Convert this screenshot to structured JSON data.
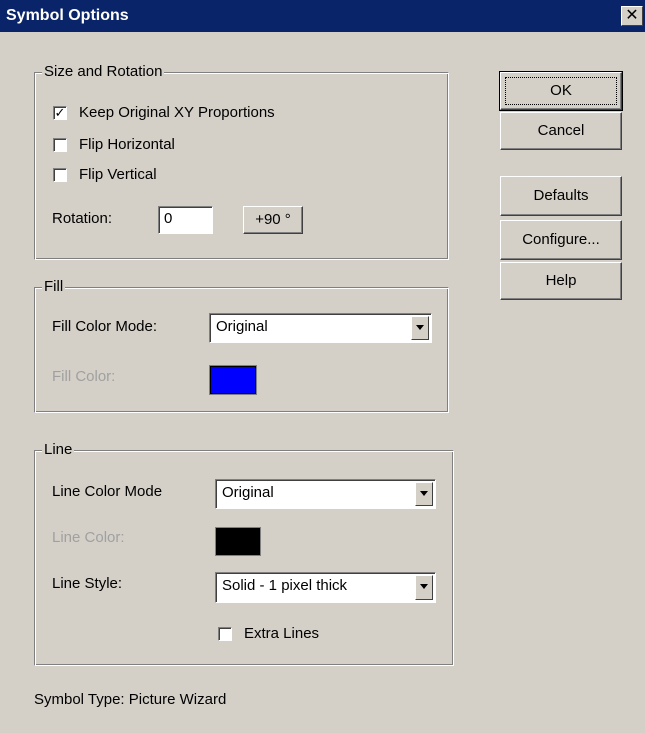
{
  "window": {
    "title": "Symbol Options",
    "close_glyph": "✕"
  },
  "size_rotation": {
    "legend": "Size and Rotation",
    "keep_proportions": {
      "label": "Keep Original XY Proportions",
      "checked": true
    },
    "flip_horizontal": {
      "label": "Flip Horizontal",
      "checked": false
    },
    "flip_vertical": {
      "label": "Flip Vertical",
      "checked": false
    },
    "rotation_label": "Rotation:",
    "rotation_value": "0",
    "rotate_button": "+90 °"
  },
  "fill": {
    "legend": "Fill",
    "mode_label": "Fill Color Mode:",
    "mode_value": "Original",
    "color_label": "Fill Color:",
    "color": "#0000ff"
  },
  "line": {
    "legend": "Line",
    "mode_label": "Line Color Mode",
    "mode_value": "Original",
    "color_label": "Line Color:",
    "color": "#000000",
    "style_label": "Line Style:",
    "style_value": "Solid - 1 pixel thick",
    "extra_lines": {
      "label": "Extra Lines",
      "checked": false
    }
  },
  "buttons": {
    "ok": "OK",
    "cancel": "Cancel",
    "defaults": "Defaults",
    "configure": "Configure...",
    "help": "Help"
  },
  "footer": {
    "symbol_type": "Symbol Type: Picture Wizard"
  },
  "check_glyph": "✓",
  "icons": {
    "close": "close-icon",
    "dropdown": "chevron-down-icon",
    "check": "check-icon"
  }
}
